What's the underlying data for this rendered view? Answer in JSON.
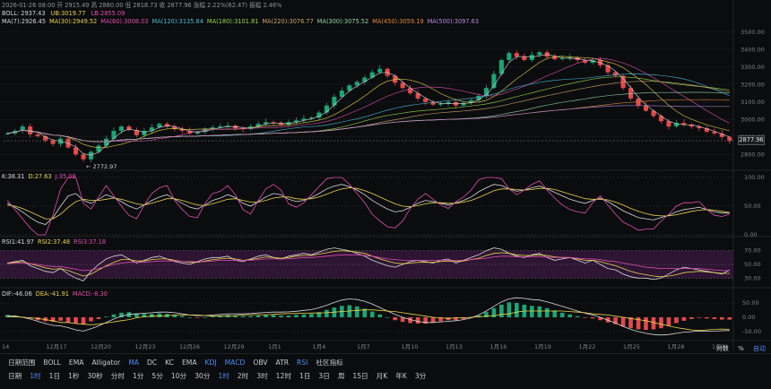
{
  "header": {
    "line1": "2026-01-26 08:00  开 2915.49  高 2880.00  低 2818.73  收 2877.96  涨幅 2.22%(62.47)  振幅 2.46%",
    "line2": {
      "label": "BOLL: 2937.43",
      "ub": "UB:3019.77",
      "lb": "LB:2855.09"
    },
    "line3": [
      {
        "text": "MA(7):2926.45",
        "color": "#d8d8d8"
      },
      {
        "text": "MA(30):2949.52",
        "color": "#e8d44d"
      },
      {
        "text": "MA(60):3008.03",
        "color": "#e04fb0"
      },
      {
        "text": "MA(120):3135.84",
        "color": "#46b8d8"
      },
      {
        "text": "MA(180):3101.81",
        "color": "#9bd84a"
      },
      {
        "text": "MA(220):3076.77",
        "color": "#c8a86a"
      },
      {
        "text": "MA(300):3075.52",
        "color": "#8fd8a8"
      },
      {
        "text": "MA(450):3059.19",
        "color": "#e08a3a"
      },
      {
        "text": "MA(500):3097.63",
        "color": "#b28ae0"
      }
    ]
  },
  "current_price": "2877.96",
  "low_marker": "2772.97",
  "indicator_headers": {
    "kdj": [
      {
        "text": "K:38.31",
        "color": "#d8d8d8"
      },
      {
        "text": "D:27.63",
        "color": "#e8d44d"
      },
      {
        "text": "J:35.08",
        "color": "#e04fb0"
      }
    ],
    "rsi": [
      {
        "text": "RSI1:41.97",
        "color": "#d8d8d8"
      },
      {
        "text": "RSI2:37.48",
        "color": "#e8d44d"
      },
      {
        "text": "RSI3:37.18",
        "color": "#e04fb0"
      }
    ],
    "macd": [
      {
        "text": "DIF:-46.06",
        "color": "#d8d8d8"
      },
      {
        "text": "DEA:-41.91",
        "color": "#e8d44d"
      },
      {
        "text": "MACD:-8.30",
        "color": "#e04fb0"
      }
    ]
  },
  "toolbar1": [
    "日期范围",
    "BOLL",
    "EMA",
    "Alligator",
    "MA",
    "DC",
    "KC",
    "EMA",
    "KDJ",
    "MACD",
    "OBV",
    "ATR",
    "RSI",
    "社区指标"
  ],
  "toolbar1_active": [
    "MA",
    "KDJ",
    "MACD",
    "RSI"
  ],
  "toolbar2": [
    "日期",
    "1时",
    "1日",
    "1秒",
    "30秒",
    "分时",
    "1分",
    "5分",
    "10分",
    "30分",
    "1时",
    "2时",
    "3时",
    "12时",
    "1日",
    "3日",
    "周",
    "15日",
    "月K",
    "年K",
    "3分"
  ],
  "toolbar2_active": [
    "1时"
  ],
  "right_controls": {
    "log": "对数",
    "pct": "%",
    "auto": "自动"
  },
  "colors": {
    "up": "#1aa574",
    "down": "#e24a4a",
    "bg": "#0b0c0e",
    "grid": "#1b1d21",
    "accent": "#4b8df8"
  },
  "chart_data": [
    {
      "type": "candlestick",
      "name": "price",
      "x_ticks": [
        "14",
        "12月17",
        "12月20",
        "12月23",
        "12月26",
        "12月29",
        "1月1",
        "1月4",
        "1月7",
        "1月10",
        "1月13",
        "1月16",
        "1月19",
        "1月22",
        "1月25",
        "1月28",
        "1月31"
      ],
      "y_ticks": [
        2800,
        2900,
        3000,
        3100,
        3200,
        3300,
        3400,
        3500
      ],
      "ylim": [
        2740,
        3540
      ],
      "close_series": [
        2920,
        2935,
        2960,
        2915,
        2905,
        2880,
        2860,
        2890,
        2840,
        2800,
        2772,
        2815,
        2850,
        2890,
        2935,
        2960,
        2940,
        2910,
        2935,
        2955,
        2975,
        2960,
        2945,
        2935,
        2920,
        2930,
        2945,
        2955,
        2960,
        2965,
        2950,
        2945,
        2960,
        2975,
        2985,
        2980,
        2970,
        2985,
        2995,
        3005,
        3010,
        3040,
        3080,
        3130,
        3165,
        3195,
        3215,
        3240,
        3270,
        3290,
        3250,
        3210,
        3180,
        3150,
        3120,
        3100,
        3085,
        3090,
        3100,
        3080,
        3095,
        3110,
        3135,
        3180,
        3260,
        3340,
        3380,
        3360,
        3340,
        3370,
        3385,
        3360,
        3345,
        3350,
        3355,
        3340,
        3325,
        3340,
        3310,
        3270,
        3250,
        3180,
        3120,
        3080,
        3050,
        3020,
        2990,
        2960,
        2980,
        2970,
        2960,
        2950,
        2930,
        2920,
        2900,
        2877.96
      ]
    },
    {
      "type": "line",
      "name": "KDJ",
      "y_ticks": [
        0,
        50,
        100
      ],
      "ylim": [
        0,
        100
      ],
      "series": [
        {
          "name": "K",
          "color": "#d8d8d8",
          "values": [
            55,
            48,
            40,
            30,
            22,
            18,
            30,
            50,
            68,
            72,
            60,
            55,
            62,
            70,
            65,
            58,
            50,
            45,
            52,
            60,
            66,
            70,
            62,
            55,
            48,
            45,
            52,
            60,
            64,
            70,
            65,
            55,
            50,
            58,
            66,
            72,
            70,
            62,
            58,
            60,
            65,
            72,
            80,
            85,
            88,
            84,
            78,
            70,
            60,
            52,
            45,
            40,
            42,
            48,
            55,
            60,
            58,
            55,
            52,
            56,
            60,
            66,
            75,
            82,
            88,
            86,
            80,
            76,
            78,
            82,
            85,
            80,
            74,
            68,
            62,
            58,
            55,
            60,
            64,
            58,
            50,
            42,
            36,
            30,
            28,
            26,
            30,
            34,
            40,
            44,
            46,
            48,
            44,
            40,
            38,
            38
          ]
        },
        {
          "name": "D",
          "color": "#e8d44d",
          "values": [
            52,
            50,
            46,
            40,
            34,
            28,
            28,
            36,
            48,
            58,
            62,
            60,
            60,
            62,
            64,
            62,
            58,
            54,
            52,
            55,
            59,
            63,
            63,
            60,
            56,
            52,
            51,
            54,
            58,
            62,
            63,
            60,
            57,
            57,
            60,
            64,
            66,
            66,
            63,
            62,
            63,
            66,
            71,
            76,
            80,
            82,
            81,
            77,
            72,
            66,
            60,
            54,
            50,
            49,
            51,
            54,
            56,
            56,
            55,
            55,
            57,
            60,
            65,
            71,
            77,
            80,
            80,
            79,
            78,
            79,
            81,
            81,
            79,
            75,
            71,
            67,
            63,
            62,
            62,
            61,
            57,
            52,
            46,
            41,
            37,
            34,
            33,
            33,
            35,
            38,
            41,
            43,
            44,
            43,
            41,
            39
          ]
        },
        {
          "name": "J",
          "color": "#e04fb0",
          "values": [
            60,
            44,
            28,
            12,
            0,
            0,
            35,
            80,
            108,
            100,
            55,
            45,
            66,
            86,
            68,
            50,
            34,
            28,
            52,
            72,
            82,
            86,
            60,
            44,
            32,
            30,
            55,
            72,
            76,
            86,
            70,
            44,
            36,
            60,
            80,
            88,
            78,
            54,
            48,
            56,
            70,
            84,
            98,
            100,
            100,
            88,
            72,
            56,
            36,
            24,
            14,
            12,
            24,
            46,
            62,
            72,
            62,
            52,
            46,
            58,
            66,
            78,
            96,
            100,
            100,
            98,
            80,
            70,
            78,
            88,
            94,
            78,
            64,
            52,
            44,
            40,
            38,
            56,
            68,
            52,
            36,
            22,
            16,
            8,
            10,
            10,
            24,
            36,
            50,
            56,
            56,
            58,
            44,
            34,
            32,
            36
          ]
        }
      ]
    },
    {
      "type": "line",
      "name": "RSI",
      "y_ticks": [
        30,
        50,
        70
      ],
      "ylim": [
        20,
        80
      ],
      "series": [
        {
          "name": "RSI1",
          "color": "#d8d8d8",
          "values": [
            52,
            54,
            56,
            48,
            44,
            40,
            38,
            44,
            36,
            30,
            26,
            40,
            50,
            58,
            62,
            64,
            58,
            52,
            56,
            60,
            62,
            58,
            54,
            52,
            50,
            54,
            58,
            60,
            60,
            62,
            56,
            54,
            58,
            62,
            64,
            60,
            58,
            62,
            64,
            66,
            64,
            68,
            72,
            74,
            72,
            70,
            66,
            62,
            56,
            52,
            48,
            46,
            50,
            54,
            56,
            54,
            52,
            56,
            58,
            52,
            56,
            60,
            64,
            70,
            74,
            72,
            66,
            62,
            60,
            64,
            66,
            60,
            56,
            58,
            60,
            56,
            52,
            56,
            50,
            44,
            42,
            36,
            32,
            30,
            30,
            28,
            30,
            36,
            42,
            46,
            44,
            42,
            40,
            38,
            36,
            42
          ]
        },
        {
          "name": "RSI2",
          "color": "#e8d44d",
          "values": [
            52,
            53,
            54,
            51,
            48,
            45,
            43,
            44,
            41,
            37,
            33,
            36,
            42,
            48,
            53,
            57,
            57,
            55,
            55,
            57,
            58,
            58,
            56,
            54,
            53,
            53,
            55,
            57,
            58,
            59,
            58,
            56,
            57,
            59,
            61,
            60,
            59,
            60,
            62,
            63,
            63,
            65,
            67,
            69,
            70,
            69,
            68,
            66,
            62,
            58,
            55,
            52,
            51,
            52,
            53,
            53,
            53,
            54,
            55,
            54,
            55,
            57,
            59,
            63,
            66,
            67,
            66,
            64,
            63,
            63,
            64,
            63,
            61,
            60,
            60,
            58,
            56,
            56,
            54,
            51,
            48,
            44,
            40,
            37,
            35,
            33,
            32,
            33,
            35,
            38,
            39,
            40,
            39,
            38,
            37,
            37
          ]
        },
        {
          "name": "RSI3",
          "color": "#e04fb0",
          "values": [
            51,
            52,
            52,
            51,
            50,
            48,
            47,
            47,
            45,
            43,
            41,
            42,
            44,
            47,
            50,
            52,
            53,
            53,
            53,
            54,
            55,
            55,
            55,
            54,
            54,
            54,
            54,
            55,
            56,
            56,
            56,
            56,
            56,
            57,
            58,
            58,
            58,
            58,
            59,
            60,
            60,
            61,
            62,
            63,
            64,
            64,
            64,
            63,
            62,
            60,
            58,
            57,
            56,
            56,
            56,
            56,
            56,
            56,
            56,
            56,
            56,
            57,
            58,
            59,
            61,
            62,
            62,
            61,
            61,
            61,
            61,
            61,
            60,
            60,
            60,
            59,
            58,
            58,
            57,
            55,
            54,
            52,
            50,
            48,
            46,
            45,
            44,
            44,
            44,
            44,
            44,
            44,
            43,
            42,
            41,
            41
          ]
        }
      ]
    },
    {
      "type": "bar",
      "name": "MACD",
      "y_ticks": [
        -50,
        0,
        50
      ],
      "ylim": [
        -75,
        75
      ],
      "histogram": [
        8,
        6,
        2,
        -4,
        -10,
        -14,
        -16,
        -12,
        -18,
        -22,
        -24,
        -14,
        -6,
        2,
        10,
        16,
        18,
        14,
        12,
        12,
        14,
        12,
        8,
        4,
        0,
        -2,
        0,
        4,
        6,
        8,
        6,
        4,
        4,
        6,
        8,
        8,
        6,
        6,
        8,
        10,
        12,
        18,
        26,
        34,
        40,
        42,
        38,
        30,
        20,
        10,
        0,
        -10,
        -16,
        -20,
        -22,
        -22,
        -18,
        -14,
        -10,
        -10,
        -6,
        -2,
        6,
        18,
        32,
        44,
        52,
        50,
        44,
        40,
        38,
        32,
        24,
        16,
        10,
        4,
        -2,
        -4,
        -10,
        -18,
        -24,
        -32,
        -38,
        -42,
        -44,
        -42,
        -38,
        -30,
        -20,
        -12,
        -6,
        -2,
        -4,
        -6,
        -8,
        -8.3
      ],
      "series": [
        {
          "name": "DIF",
          "color": "#d8d8d8",
          "values": [
            6,
            4,
            0,
            -6,
            -14,
            -22,
            -28,
            -30,
            -36,
            -44,
            -48,
            -40,
            -30,
            -18,
            -6,
            4,
            10,
            12,
            14,
            16,
            18,
            18,
            16,
            12,
            8,
            6,
            6,
            8,
            10,
            12,
            12,
            12,
            13,
            15,
            17,
            18,
            18,
            19,
            21,
            24,
            27,
            33,
            42,
            52,
            60,
            64,
            62,
            56,
            46,
            34,
            22,
            10,
            0,
            -8,
            -14,
            -18,
            -18,
            -16,
            -14,
            -12,
            -8,
            -2,
            8,
            22,
            38,
            54,
            64,
            68,
            66,
            62,
            60,
            54,
            46,
            38,
            30,
            22,
            14,
            8,
            0,
            -10,
            -20,
            -32,
            -42,
            -50,
            -56,
            -60,
            -62,
            -60,
            -56,
            -52,
            -50,
            -48,
            -48,
            -48,
            -47,
            -46.06
          ]
        },
        {
          "name": "DEA",
          "color": "#e8d44d",
          "values": [
            2,
            2,
            0,
            -2,
            -4,
            -8,
            -12,
            -18,
            -18,
            -22,
            -24,
            -26,
            -24,
            -20,
            -16,
            -12,
            -8,
            -2,
            2,
            4,
            4,
            6,
            8,
            8,
            8,
            8,
            6,
            4,
            4,
            4,
            6,
            8,
            9,
            9,
            9,
            10,
            12,
            13,
            13,
            14,
            15,
            15,
            16,
            18,
            20,
            22,
            24,
            26,
            26,
            24,
            22,
            20,
            16,
            12,
            8,
            4,
            0,
            -2,
            -4,
            -2,
            -2,
            0,
            2,
            4,
            6,
            10,
            12,
            18,
            22,
            22,
            22,
            22,
            22,
            22,
            20,
            18,
            16,
            12,
            10,
            8,
            4,
            0,
            -4,
            -8,
            -12,
            -18,
            -24,
            -30,
            -36,
            -40,
            -44,
            -46,
            -44,
            -42,
            -41,
            -41.91
          ]
        }
      ]
    }
  ]
}
